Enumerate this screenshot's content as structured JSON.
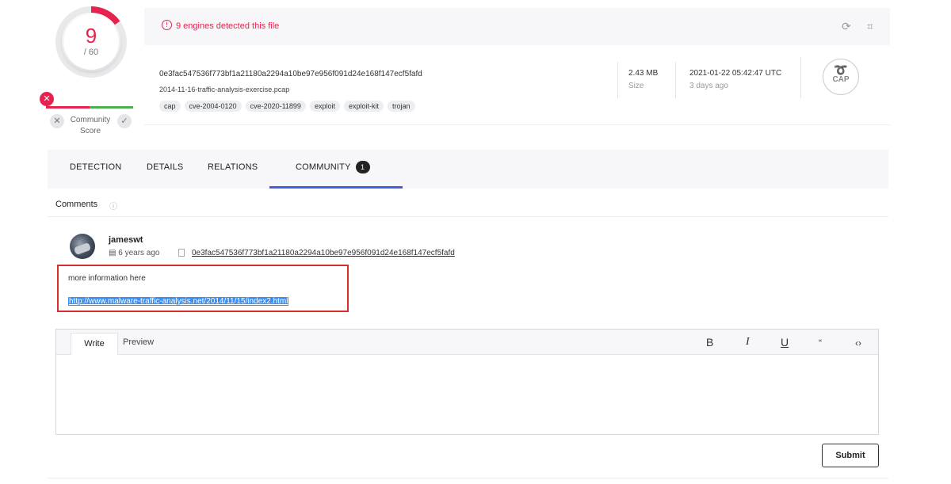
{
  "score": {
    "detected": "9",
    "total": "/ 60"
  },
  "community": {
    "label": "Community Score",
    "x_badge": "✕",
    "down": "✕",
    "up": "✓"
  },
  "detection_banner": {
    "icon": "!",
    "text": "9 engines detected this file"
  },
  "toolbar_icons": {
    "refresh": "⟳",
    "graph": "⌗"
  },
  "file": {
    "hash": "0e3fac547536f773bf1a21180a2294a10be97e956f091d24e168f147ecf5fafd",
    "name": "2014-11-16-traffic-analysis-exercise.pcap",
    "tags": [
      "cap",
      "cve-2004-0120",
      "cve-2020-11899",
      "exploit",
      "exploit-kit",
      "trojan"
    ],
    "size": "2.43 MB",
    "size_label": "Size",
    "date": "2021-01-22 05:42:47 UTC",
    "date_relative": "3 days ago",
    "type_icon_label": "CAP"
  },
  "tabs": [
    {
      "label": "DETECTION"
    },
    {
      "label": "DETAILS"
    },
    {
      "label": "RELATIONS"
    },
    {
      "label": "COMMUNITY",
      "badge": "1"
    }
  ],
  "comments": {
    "title": "Comments",
    "info_icon": "ⓘ",
    "items": [
      {
        "author": "jameswt",
        "time": "6 years ago",
        "hash": "0e3fac547536f773bf1a21180a2294a10be97e956f091d24e168f147ecf5fafd",
        "text": "more information here",
        "link": "http://www.malware-traffic-analysis.net/2014/11/15/index2.html"
      }
    ]
  },
  "editor": {
    "tab_write": "Write",
    "tab_preview": "Preview",
    "format": {
      "bold": "B",
      "italic": "I",
      "underline": "U",
      "quote": "“",
      "code": "‹›"
    },
    "submit": "Submit"
  },
  "colors": {
    "accent_red": "#e6224e",
    "tab_underline": "#3f5fe0",
    "highlight_box": "#d32f2f"
  }
}
